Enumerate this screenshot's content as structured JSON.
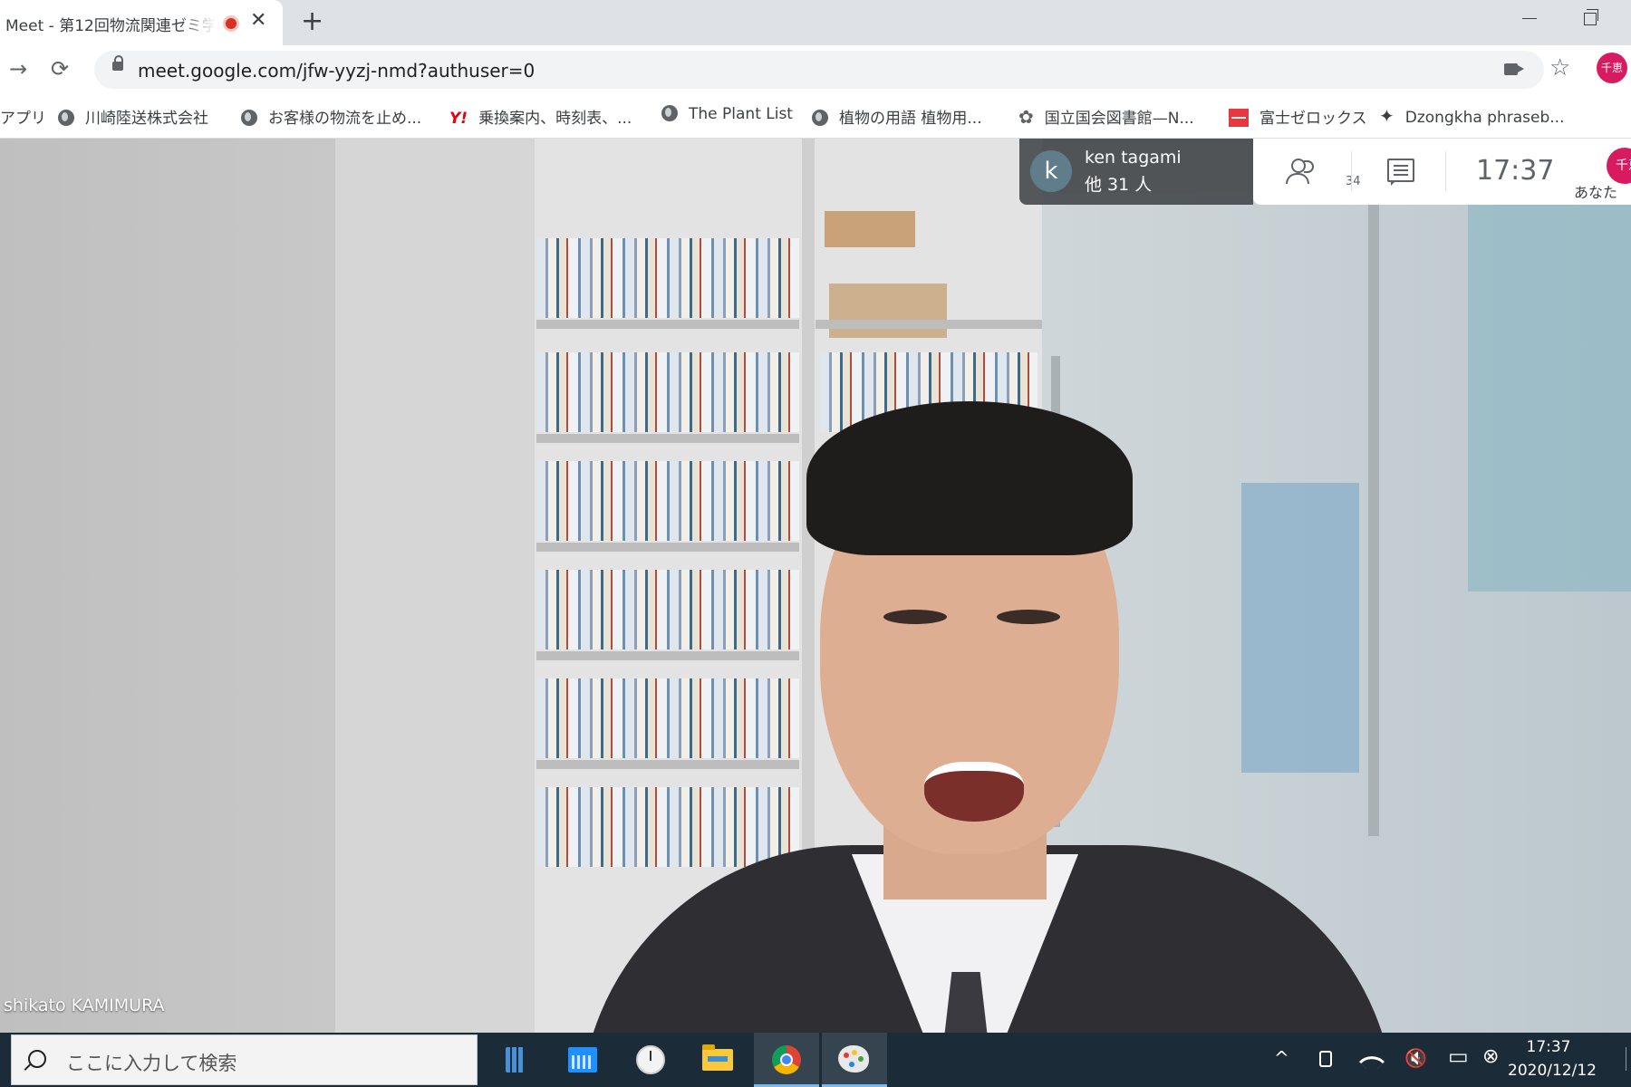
{
  "browser": {
    "tab_title": "Meet - 第12回物流関連ゼミ学",
    "tab_close": "✕",
    "new_tab": "+",
    "url": "meet.google.com/jfw-yyzj-nmd?authuser=0",
    "profile_initials": "千恵",
    "back": "→",
    "reload": "⟳",
    "star": "☆"
  },
  "bookmarks": [
    {
      "label": "アプリ"
    },
    {
      "label": "川崎陸送株式会社"
    },
    {
      "label": "お客様の物流を止め..."
    },
    {
      "label": "乗換案内、時刻表、..."
    },
    {
      "label": "The Plant List"
    },
    {
      "label": "植物の用語 植物用..."
    },
    {
      "label": "国立国会図書館—N..."
    },
    {
      "label": "富士ゼロックス"
    },
    {
      "label": "Dzongkha phraseb..."
    }
  ],
  "bookmark_icons": {
    "yahoo": "Y!",
    "flower": "✿",
    "spark": "✦"
  },
  "meet": {
    "speaker_initial": "k",
    "speaker_name": "ken tagami",
    "speaker_others": "他 31 人",
    "participant_count": "34",
    "time": "17:37",
    "self_initials": "千恵",
    "self_label": "あなた",
    "video_name": "shikato KAMIMURA"
  },
  "taskbar": {
    "search_placeholder": "ここに入力して検索",
    "tray_chevron": "^",
    "tray_volume": "🔇",
    "tray_battery": "▭",
    "tray_close": "⊗",
    "time": "17:37",
    "date": "2020/12/12"
  },
  "colors": {
    "rec": "#d93025",
    "profile": "#d81b60",
    "taskbar": "#1b2b38"
  }
}
